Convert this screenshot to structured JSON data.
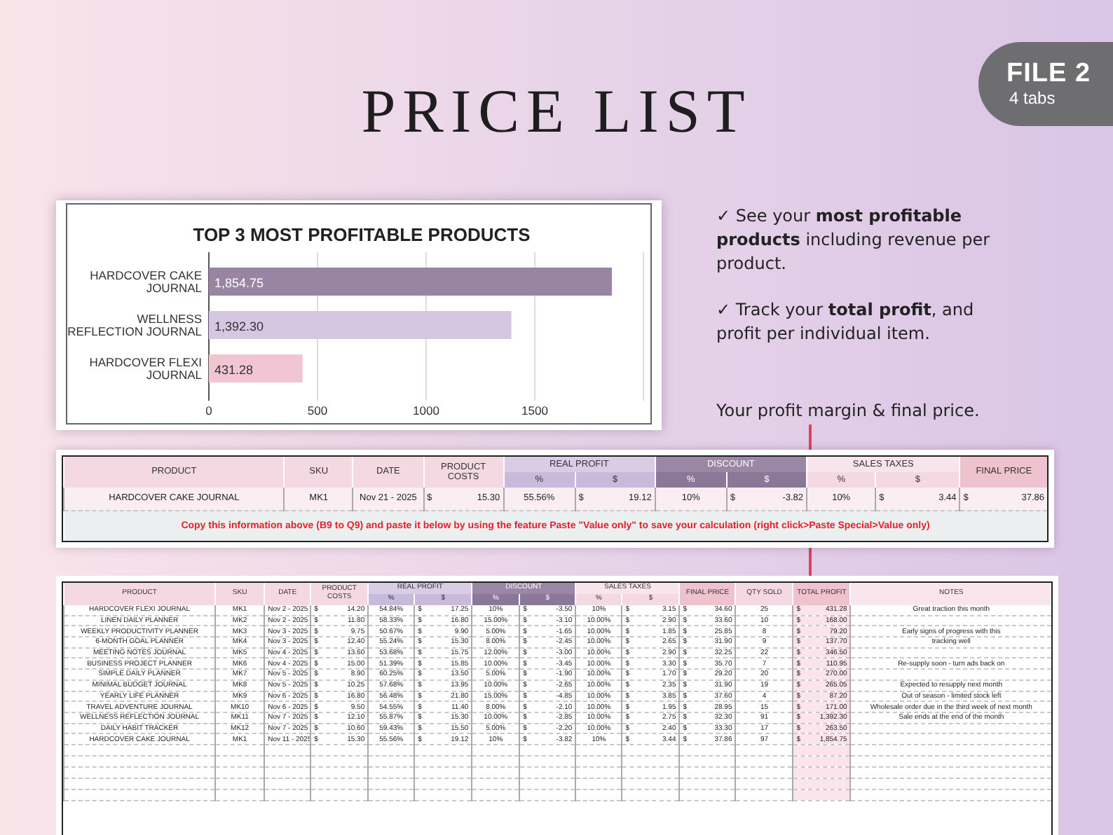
{
  "title": "PRICE LIST",
  "badge": {
    "title": "FILE 2",
    "subtitle": "4 tabs"
  },
  "chart": {
    "chart_data": {
      "type": "bar",
      "orientation": "horizontal",
      "title": "TOP 3 MOST PROFITABLE PRODUCTS",
      "categories": [
        "HARDCOVER CAKE JOURNAL",
        "WELLNESS REFLECTION JOURNAL",
        "HARDCOVER FLEXI JOURNAL"
      ],
      "values": [
        1854.75,
        1392.3,
        431.28
      ],
      "xlim": [
        0,
        2000
      ],
      "xticks": [
        0,
        500,
        1000,
        1500
      ],
      "grid": true,
      "value_labels": [
        "1,854.75",
        "1,392.30",
        "431.28"
      ]
    }
  },
  "highlights": [
    "✓ See your **most profitable products**  including revenue per product.",
    "✓ Track your **total profit**, and profit per individual item."
  ],
  "caption": "Your profit margin & final price.",
  "calculator": {
    "header_groups": [
      {
        "label": "PRODUCT"
      },
      {
        "label": "SKU"
      },
      {
        "label": "DATE"
      },
      {
        "label": "PRODUCT COSTS"
      },
      {
        "label": "REAL PROFIT",
        "sub": [
          "%",
          "$"
        ]
      },
      {
        "label": "DISCOUNT",
        "sub": [
          "%",
          "$"
        ]
      },
      {
        "label": "SALES TAXES",
        "sub": [
          "%",
          "$"
        ]
      },
      {
        "label": "FINAL PRICE"
      }
    ],
    "row": [
      "HARDCOVER CAKE JOURNAL",
      "MK1",
      "Nov 21 - 2025",
      "$ 15.30",
      "55.56%",
      "$ 19.12",
      "10%",
      "$ -3.82",
      "10%",
      "$ 3.44",
      "$ 37.86"
    ],
    "note": "Copy this information above (B9 to Q9) and paste it below by using the feature Paste \"Value only\" to save your calculation (right click>Paste Special>Value only)"
  },
  "price_table": {
    "header_groups": [
      {
        "label": "PRODUCT"
      },
      {
        "label": "SKU"
      },
      {
        "label": "DATE"
      },
      {
        "label": "PRODUCT COSTS"
      },
      {
        "label": "REAL PROFIT",
        "sub": [
          "%",
          "$"
        ]
      },
      {
        "label": "DISCOUNT",
        "sub": [
          "%",
          "$"
        ]
      },
      {
        "label": "SALES TAXES",
        "sub": [
          "%",
          "$"
        ]
      },
      {
        "label": "FINAL PRICE"
      },
      {
        "label": "QTY SOLD"
      },
      {
        "label": "TOTAL PROFIT"
      },
      {
        "label": "NOTES"
      }
    ],
    "rows": [
      [
        "HARDCOVER FLEXI JOURNAL",
        "MK1",
        "Nov 2 - 2025",
        "$ 14.20",
        "54.84%",
        "$ 17.25",
        "10%",
        "$ -3.50",
        "10%",
        "$ 3.15",
        "$ 34.60",
        "25",
        "$ 431.28",
        "Great traction this month"
      ],
      [
        "LINEN DAILY PLANNER",
        "MK2",
        "Nov 2 - 2025",
        "$ 11.80",
        "58.33%",
        "$ 16.80",
        "15.00%",
        "$ -3.10",
        "10.00%",
        "$ 2.90",
        "$ 33.60",
        "10",
        "$ 168.00",
        ""
      ],
      [
        "WEEKLY PRODUCTIVITY PLANNER",
        "MK3",
        "Nov 3 - 2025",
        "$ 9.75",
        "50.67%",
        "$ 9.90",
        "5.00%",
        "$ -1.65",
        "10.00%",
        "$ 1.85",
        "$ 25.85",
        "8",
        "$ 79.20",
        "Early signs of progress with this"
      ],
      [
        "6-MONTH GOAL PLANNER",
        "MK4",
        "Nov 3 - 2025",
        "$ 12.40",
        "55.24%",
        "$ 15.30",
        "8.00%",
        "$ -2.45",
        "10.00%",
        "$ 2.65",
        "$ 31.90",
        "9",
        "$ 137.70",
        "tracking well"
      ],
      [
        "MEETING NOTES JOURNAL",
        "MK5",
        "Nov 4 - 2025",
        "$ 13.60",
        "53.68%",
        "$ 15.75",
        "12.00%",
        "$ -3.00",
        "10.00%",
        "$ 2.90",
        "$ 32.25",
        "22",
        "$ 346.50",
        ""
      ],
      [
        "BUSINESS PROJECT PLANNER",
        "MK6",
        "Nov 4 - 2025",
        "$ 15.00",
        "51.39%",
        "$ 15.85",
        "10.00%",
        "$ -3.45",
        "10.00%",
        "$ 3.30",
        "$ 35.70",
        "7",
        "$ 110.95",
        "Re-supply soon - turn ads back on"
      ],
      [
        "SIMPLE DAILY PLANNER",
        "MK7",
        "Nov 5 - 2025",
        "$ 8.90",
        "60.25%",
        "$ 13.50",
        "5.00%",
        "$ -1.90",
        "10.00%",
        "$ 1.70",
        "$ 29.20",
        "20",
        "$ 270.00",
        ""
      ],
      [
        "MINIMAL BUDGET JOURNAL",
        "MK8",
        "Nov 5 - 2025",
        "$ 10.25",
        "57.68%",
        "$ 13.95",
        "10.00%",
        "$ -2.65",
        "10.00%",
        "$ 2.35",
        "$ 31.90",
        "19",
        "$ 265.05",
        "Expected to resupply next month"
      ],
      [
        "YEARLY LIFE PLANNER",
        "MK9",
        "Nov 6 - 2025",
        "$ 16.80",
        "56.48%",
        "$ 21.80",
        "15.00%",
        "$ -4.85",
        "10.00%",
        "$ 3.85",
        "$ 37.60",
        "4",
        "$ 87.20",
        "Out of season - limited stock left"
      ],
      [
        "TRAVEL ADVENTURE JOURNAL",
        "MK10",
        "Nov 6 - 2025",
        "$ 9.50",
        "54.55%",
        "$ 11.40",
        "8.00%",
        "$ -2.10",
        "10.00%",
        "$ 1.95",
        "$ 28.95",
        "15",
        "$ 171.00",
        "Wholesale order due in the third week of next month"
      ],
      [
        "WELLNESS REFLECTION JOURNAL",
        "MK11",
        "Nov 7 - 2025",
        "$ 12.10",
        "55.87%",
        "$ 15.30",
        "10.00%",
        "$ -2.85",
        "10.00%",
        "$ 2.75",
        "$ 32.30",
        "91",
        "$ 1,392.30",
        "Sale ends at the end of the month"
      ],
      [
        "DAILY HABIT TRACKER",
        "MK12",
        "Nov 7 - 2025",
        "$ 10.60",
        "59.43%",
        "$ 15.50",
        "5.00%",
        "$ -2.20",
        "10.00%",
        "$ 2.40",
        "$ 33.30",
        "17",
        "$ 263.50",
        ""
      ],
      [
        "HARDCOVER CAKE JOURNAL",
        "MK1",
        "Nov 11 - 2025",
        "$ 15.30",
        "55.56%",
        "$ 19.12",
        "10%",
        "$ -3.82",
        "10%",
        "$ 3.44",
        "$ 37.86",
        "97",
        "$ 1,854.75",
        ""
      ]
    ]
  }
}
